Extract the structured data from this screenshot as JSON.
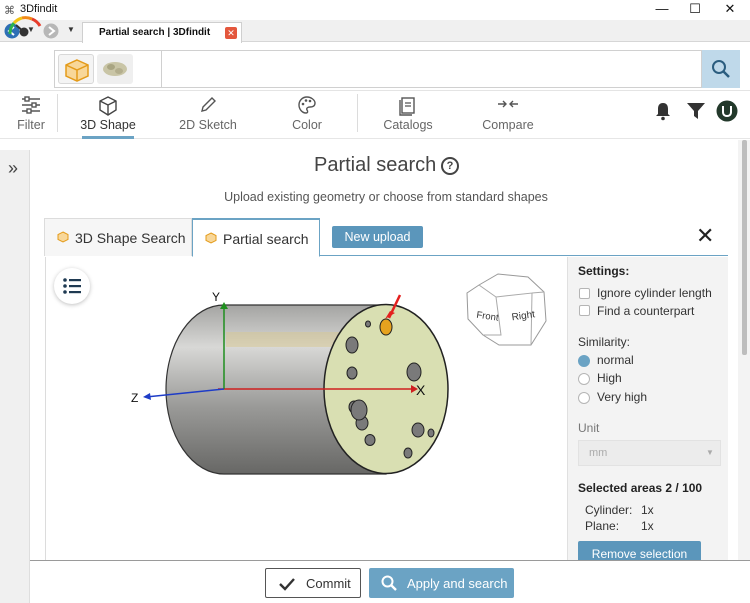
{
  "window": {
    "title": "3Dfindit",
    "minimize": "—",
    "maximize": "☐",
    "close": "✕"
  },
  "browser_tab": {
    "title": "Partial search | 3Dfindit",
    "close": "✕"
  },
  "search": {
    "clear": "✕",
    "placeholder": ""
  },
  "toolbar": {
    "filter": "Filter",
    "shape": "3D Shape",
    "sketch": "2D Sketch",
    "color": "Color",
    "catalogs": "Catalogs",
    "compare": "Compare"
  },
  "page": {
    "title": "Partial search",
    "help": "?",
    "subtitle": "Upload existing geometry or choose from standard shapes"
  },
  "tabs": {
    "shape_search": "3D Shape Search",
    "partial_search": "Partial search",
    "new_upload": "New upload",
    "close": "✕"
  },
  "viewer": {
    "axis_x": "X",
    "axis_y": "Y",
    "axis_z": "Z",
    "cube_front": "Front",
    "cube_right": "Right"
  },
  "settings": {
    "heading": "Settings:",
    "ignore_cylinder": "Ignore cylinder length",
    "find_counterpart": "Find a counterpart",
    "similarity_label": "Similarity:",
    "similarity_options": [
      "normal",
      "High",
      "Very high"
    ],
    "similarity_selected": "normal",
    "unit_label": "Unit",
    "unit_value": "mm",
    "selected_areas": "Selected areas 2 / 100",
    "cylinder_label": "Cylinder:",
    "cylinder_count": "1x",
    "plane_label": "Plane:",
    "plane_count": "1x",
    "remove_selection": "Remove selection"
  },
  "footer": {
    "commit": "Commit",
    "apply": "Apply and search"
  },
  "colors": {
    "accent": "#6ba3c4",
    "button": "#5b96bb",
    "search_button": "#bfd9ea",
    "marker": "#e4201e"
  }
}
